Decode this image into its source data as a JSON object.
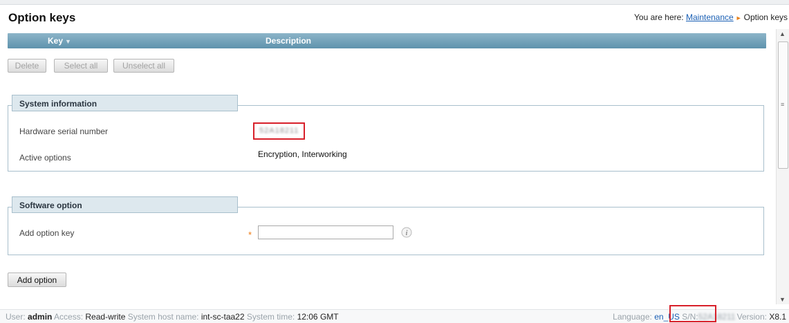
{
  "page": {
    "title": "Option keys",
    "breadcrumb": {
      "prefix": "You are here:",
      "link": "Maintenance",
      "current": "Option keys"
    }
  },
  "table": {
    "columns": [
      {
        "label": "Key",
        "sort_icon": "triangle-down-icon"
      },
      {
        "label": "Description"
      }
    ]
  },
  "actions": {
    "delete": "Delete",
    "select_all": "Select all",
    "unselect_all": "Unselect all",
    "add_option": "Add option"
  },
  "system_information": {
    "heading": "System information",
    "serial_label": "Hardware serial number",
    "serial_value": "52A18211",
    "active_label": "Active options",
    "active_value": "Encryption, Interworking"
  },
  "software_option": {
    "heading": "Software option",
    "add_key_label": "Add option key",
    "add_key_value": "",
    "required_mark": "*",
    "info_icon": "info-icon"
  },
  "footer": {
    "user_label": "User:",
    "user_value": "admin",
    "access_label": "Access:",
    "access_value": "Read-write",
    "host_label": "System host name:",
    "host_value": "int-sc-taa22",
    "time_label": "System time:",
    "time_value": "12:06 GMT",
    "language_label": "Language:",
    "language_value": "en_US",
    "sn_label": "S/N:",
    "sn_value": "52A18211",
    "version_label": "Version:",
    "version_value": "X8.1"
  },
  "colors": {
    "header_bar": "#6f9fb8",
    "section_tab": "#dde8ee",
    "highlight": "#d8202a",
    "required": "#ee7a12",
    "link": "#1a5fb4"
  }
}
